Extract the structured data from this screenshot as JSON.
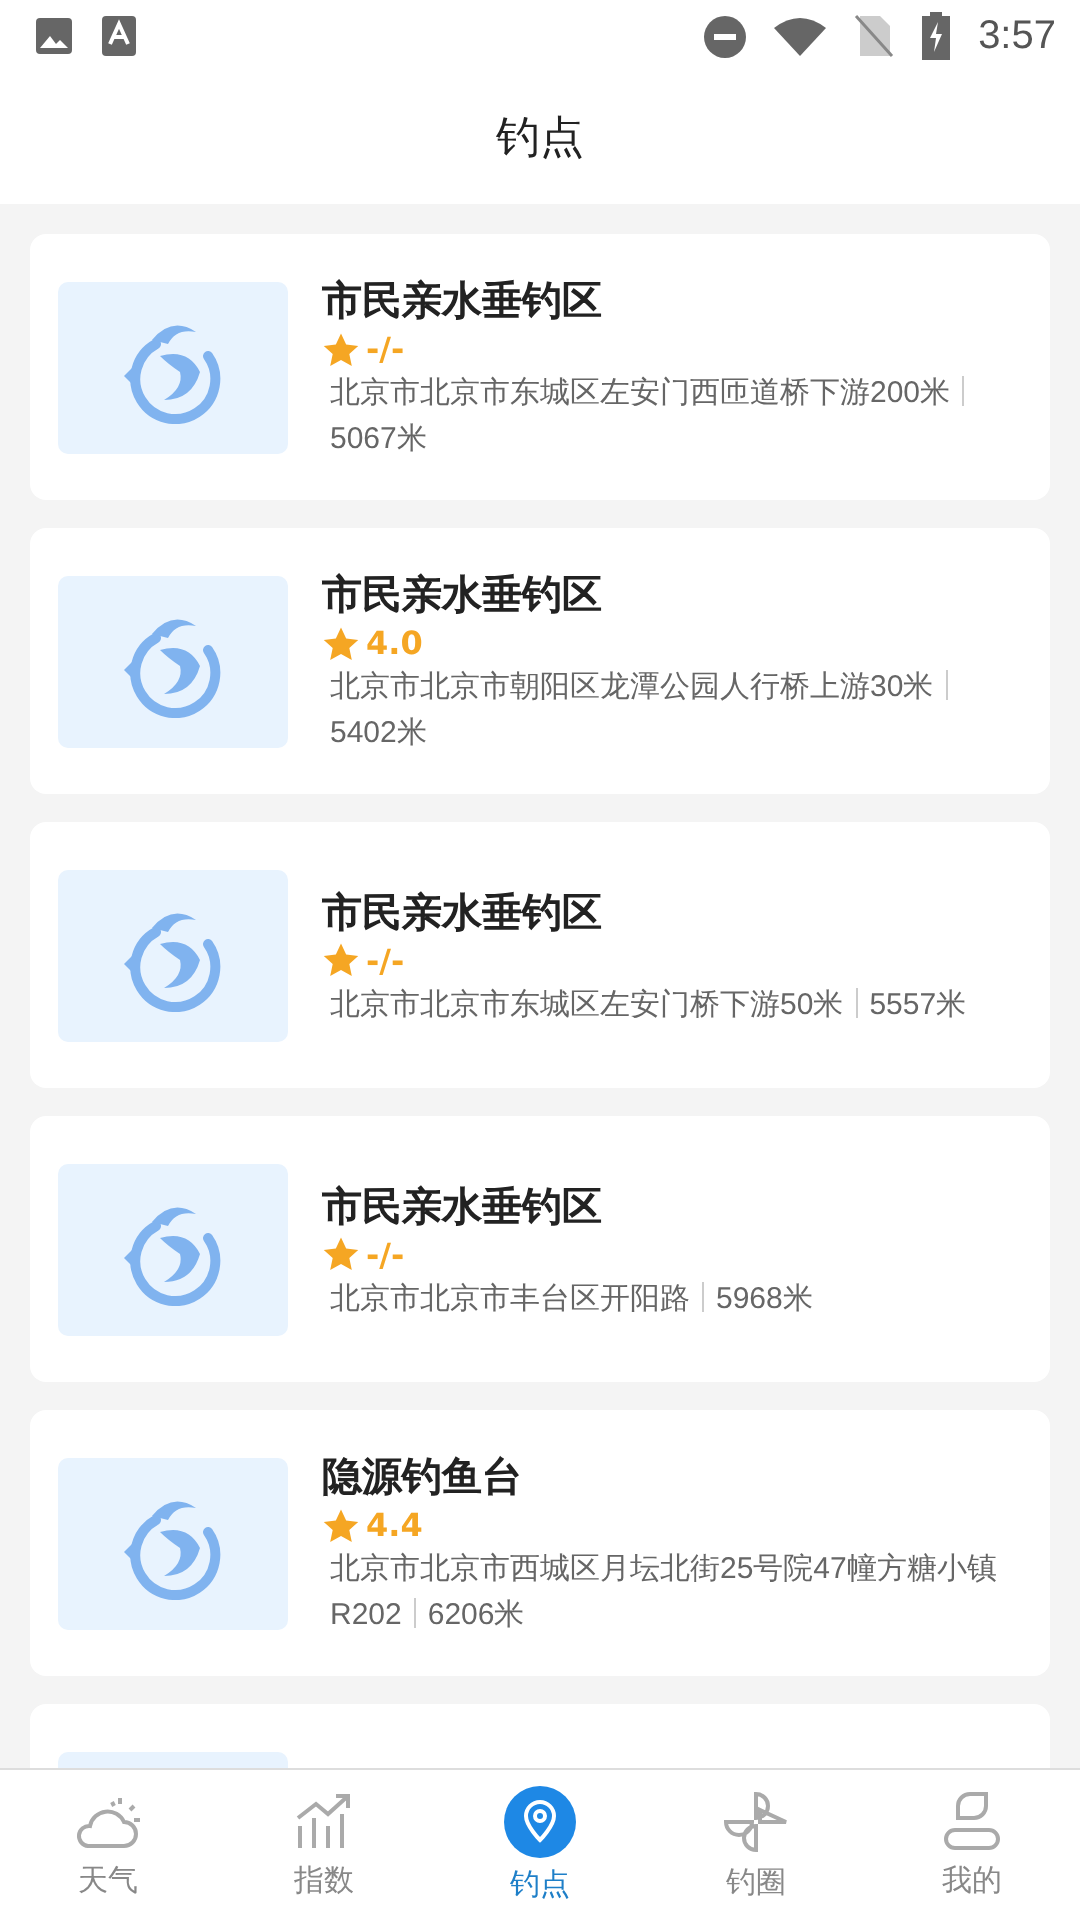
{
  "status_bar": {
    "time": "3:57"
  },
  "header": {
    "title": "钓点"
  },
  "spots": [
    {
      "name": "市民亲水垂钓区",
      "rating": "-/-",
      "address": "北京市北京市东城区左安门西匝道桥下游200米",
      "distance": "5067米"
    },
    {
      "name": "市民亲水垂钓区",
      "rating": "4.0",
      "address": "北京市北京市朝阳区龙潭公园人行桥上游30米",
      "distance": "5402米"
    },
    {
      "name": "市民亲水垂钓区",
      "rating": "-/-",
      "address": "北京市北京市东城区左安门桥下游50米",
      "distance": "5557米"
    },
    {
      "name": "市民亲水垂钓区",
      "rating": "-/-",
      "address": "北京市北京市丰台区开阳路",
      "distance": "5968米"
    },
    {
      "name": "隐源钓鱼台",
      "rating": "4.4",
      "address": "北京市北京市西城区月坛北街25号院47幢方糖小镇R202",
      "distance": "6206米"
    }
  ],
  "tabs": [
    {
      "label": "天气",
      "kind": "weather",
      "selected": false
    },
    {
      "label": "指数",
      "kind": "index",
      "selected": false
    },
    {
      "label": "钓点",
      "kind": "spot",
      "selected": true
    },
    {
      "label": "钓圈",
      "kind": "circle",
      "selected": false
    },
    {
      "label": "我的",
      "kind": "me",
      "selected": false
    }
  ]
}
